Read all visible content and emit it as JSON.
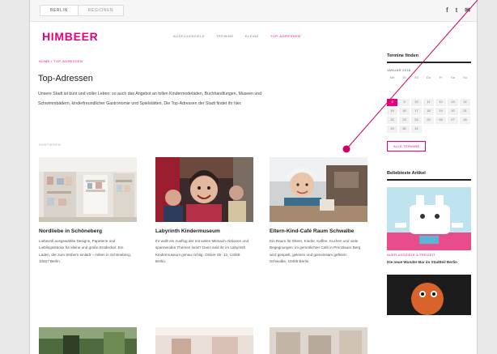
{
  "topbar": {
    "city_tabs": [
      "Berlin",
      "Regionen"
    ],
    "social": [
      "f",
      "t",
      "✉"
    ]
  },
  "header": {
    "logo": "HIMBEER",
    "nav": [
      "Ausflugsziele",
      "Termine",
      "Kleine",
      "Top-Adressen"
    ]
  },
  "breadcrumb": "Home / Top-Adressen",
  "main": {
    "title": "Top-Adressen",
    "intro": "Unsere Stadt ist bunt und voller Leben: so auch das Angebot an tollen Kindermodeläden, Buchhandlungen, Museen und Schwimmbädern, kinderfreundlicher Gastronomie und Spielstätten. Die Top-Adressen der Stadt findet ihr hier.",
    "sort_label": "Sortieren",
    "cards": [
      {
        "title": "Nordliebe in Schöneberg",
        "text": "Liebevoll ausgewählte Designs, Papeterie und Lieblingsstücke für kleine und große Entdecker. Ein Laden, der zum Stöbern einlädt – mitten in Schöneberg, 10827 Berlin."
      },
      {
        "title": "Labyrinth Kindermuseum",
        "text": "Ihr wollt ein Ausflug der mit vielen Mitmach-Aktionen und spannenden Themen lockt? Dann seid ihr im Labyrinth Kindermuseum genau richtig. Osloer Str. 12, 13359 Berlin."
      },
      {
        "title": "Eltern-Kind-Café Raum Schwalbe",
        "text": "Ein Raum für Eltern, Kinder, Kaffee, Kuchen und viele Begegnungen: im gemütlichen Café in Prenzlauer Berg wird gespielt, gelesen und gemeinsam gefeiert. Schwalbe, 10405 Berlin."
      }
    ]
  },
  "sidebar": {
    "calendar_title": "Termine finden",
    "calendar_month": "Januar 2018",
    "weekdays": [
      "Mo",
      "Di",
      "Mi",
      "Do",
      "Fr",
      "Sa",
      "So"
    ],
    "days": [
      "",
      "",
      "",
      "",
      "",
      "",
      "",
      "",
      "",
      "",
      "",
      "",
      "",
      "",
      "8",
      "9",
      "10",
      "11",
      "12",
      "13",
      "14",
      "15",
      "16",
      "17",
      "18",
      "19",
      "20",
      "21",
      "22",
      "23",
      "24",
      "25",
      "26",
      "27",
      "28",
      "29",
      "30",
      "31",
      "",
      "",
      "",
      ""
    ],
    "selected_day": "8",
    "calendar_button": "Alle Termine",
    "related_title": "Beliebteste Artikel",
    "related_category": "Ausflugsziele & Freizeit",
    "related_headline": "Die neue Wunder-Bar im Stadtteil Berlin"
  },
  "colors": {
    "accent": "#e6007e",
    "annotation": "#cc0066"
  }
}
